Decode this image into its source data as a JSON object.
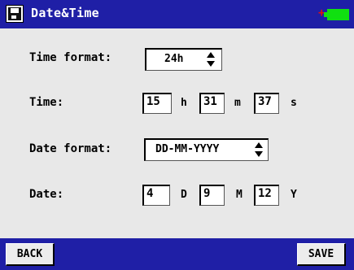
{
  "window": {
    "title": "Date&Time",
    "app_icon": "floppy-disk-icon",
    "battery": {
      "plus_sign": "+",
      "color": "#10e010"
    }
  },
  "time_format": {
    "label": "Time format:",
    "value": "24h"
  },
  "time": {
    "label": "Time:",
    "hours": "15",
    "hours_unit": "h",
    "minutes": "31",
    "minutes_unit": "m",
    "seconds": "37",
    "seconds_unit": "s"
  },
  "date_format": {
    "label": "Date format:",
    "value": "DD-MM-YYYY"
  },
  "date": {
    "label": "Date:",
    "day": "4",
    "day_unit": "D",
    "month": "9",
    "month_unit": "M",
    "year": "12",
    "year_unit": "Y"
  },
  "softkeys": {
    "back": "BACK",
    "save": "SAVE"
  },
  "colors": {
    "bar": "#1f1fa6",
    "background": "#e8e8e8",
    "accent_red": "#e01010"
  }
}
